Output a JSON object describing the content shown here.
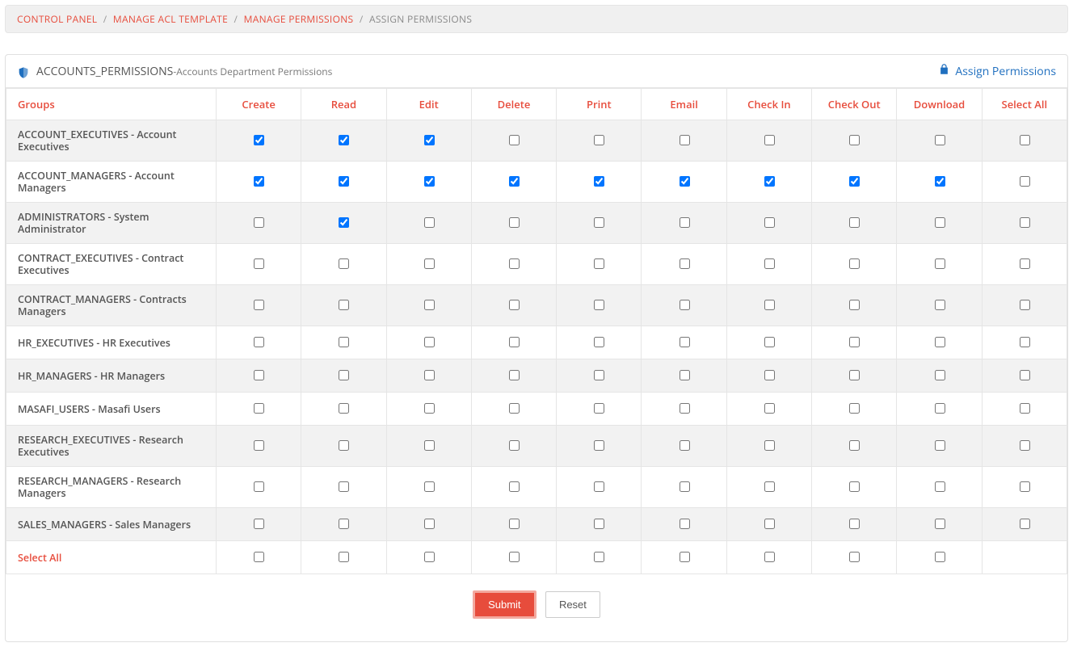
{
  "breadcrumb": {
    "items": [
      "CONTROL PANEL",
      "MANAGE ACL TEMPLATE",
      "MANAGE PERMISSIONS"
    ],
    "current": "ASSIGN PERMISSIONS"
  },
  "panel": {
    "title_strong": "ACCOUNTS_PERMISSIONS",
    "title_sep": " - ",
    "title_sub": "Accounts Department Permissions",
    "assign_label": "Assign Permissions"
  },
  "columns": [
    "Create",
    "Read",
    "Edit",
    "Delete",
    "Print",
    "Email",
    "Check In",
    "Check Out",
    "Download",
    "Select All"
  ],
  "groups_header": "Groups",
  "select_all_row_label": "Select All",
  "rows": [
    {
      "name": "ACCOUNT_EXECUTIVES - Account Executives",
      "v": [
        true,
        true,
        true,
        false,
        false,
        false,
        false,
        false,
        false,
        false
      ]
    },
    {
      "name": "ACCOUNT_MANAGERS - Account Managers",
      "v": [
        true,
        true,
        true,
        true,
        true,
        true,
        true,
        true,
        true,
        false
      ]
    },
    {
      "name": "ADMINISTRATORS - System Administrator",
      "v": [
        false,
        true,
        false,
        false,
        false,
        false,
        false,
        false,
        false,
        false
      ]
    },
    {
      "name": "CONTRACT_EXECUTIVES - Contract Executives",
      "v": [
        false,
        false,
        false,
        false,
        false,
        false,
        false,
        false,
        false,
        false
      ]
    },
    {
      "name": "CONTRACT_MANAGERS - Contracts Managers",
      "v": [
        false,
        false,
        false,
        false,
        false,
        false,
        false,
        false,
        false,
        false
      ]
    },
    {
      "name": "HR_EXECUTIVES - HR Executives",
      "v": [
        false,
        false,
        false,
        false,
        false,
        false,
        false,
        false,
        false,
        false
      ]
    },
    {
      "name": "HR_MANAGERS - HR Managers",
      "v": [
        false,
        false,
        false,
        false,
        false,
        false,
        false,
        false,
        false,
        false
      ]
    },
    {
      "name": "MASAFI_USERS - Masafi Users",
      "v": [
        false,
        false,
        false,
        false,
        false,
        false,
        false,
        false,
        false,
        false
      ]
    },
    {
      "name": "RESEARCH_EXECUTIVES - Research Executives",
      "v": [
        false,
        false,
        false,
        false,
        false,
        false,
        false,
        false,
        false,
        false
      ]
    },
    {
      "name": "RESEARCH_MANAGERS - Research Managers",
      "v": [
        false,
        false,
        false,
        false,
        false,
        false,
        false,
        false,
        false,
        false
      ]
    },
    {
      "name": "SALES_MANAGERS - Sales Managers",
      "v": [
        false,
        false,
        false,
        false,
        false,
        false,
        false,
        false,
        false,
        false
      ]
    }
  ],
  "select_all_row": [
    false,
    false,
    false,
    false,
    false,
    false,
    false,
    false,
    false
  ],
  "buttons": {
    "submit": "Submit",
    "reset": "Reset"
  }
}
